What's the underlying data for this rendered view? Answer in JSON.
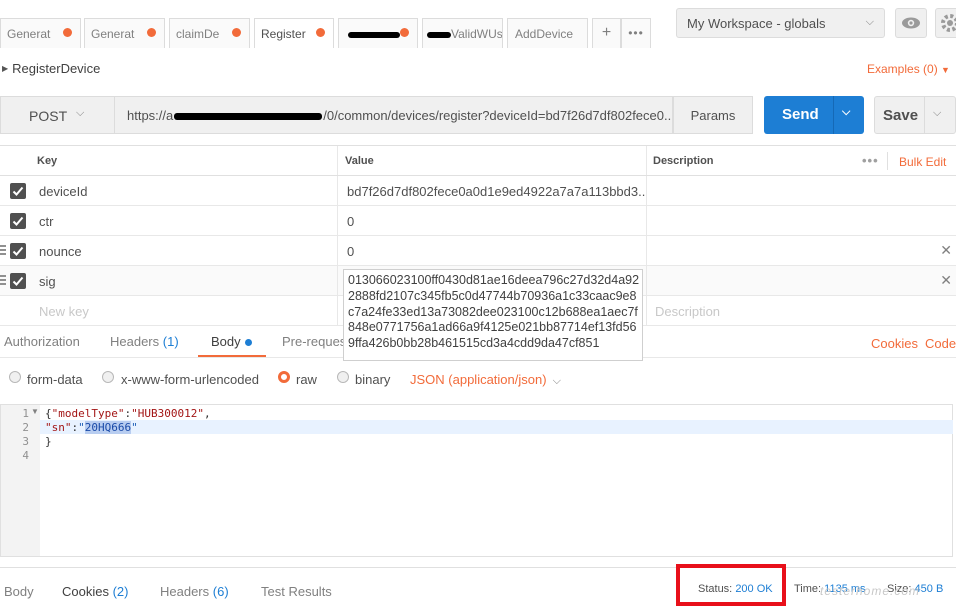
{
  "tabs": [
    {
      "label": "Generat",
      "active": false
    },
    {
      "label": "Generat",
      "active": false
    },
    {
      "label": "claimDe",
      "active": false
    },
    {
      "label": "Register",
      "active": true
    },
    {
      "label": "",
      "active": false
    },
    {
      "label": "ValidWUs",
      "active": false
    },
    {
      "label": "AddDevice",
      "active": false
    }
  ],
  "workspace": {
    "label": "My Workspace - globals"
  },
  "request": {
    "name": "RegisterDevice",
    "examples_label": "Examples (0)",
    "method": "POST",
    "url_prefix": "https://a",
    "url_suffix": "/0/common/devices/register?deviceId=bd7f26d7df802fece0...",
    "params_label": "Params",
    "send_label": "Send",
    "save_label": "Save"
  },
  "params_table": {
    "headers": {
      "key": "Key",
      "value": "Value",
      "description": "Description"
    },
    "bulk_edit": "Bulk Edit",
    "rows": [
      {
        "key": "deviceId",
        "value": "bd7f26d7df802fece0a0d1e9ed4922a7a7a113bbd3..."
      },
      {
        "key": "ctr",
        "value": "0"
      },
      {
        "key": "nounce",
        "value": "0"
      },
      {
        "key": "sig",
        "value": ""
      }
    ],
    "new_key_placeholder": "New key",
    "description_placeholder": "Description",
    "sig_full_value": "013066023100ff0430d81ae16deea796c27d32d4a922888fd2107c345fb5c0d47744b70936a1c33caac9e8c7a24fe33ed13a73082dee023100c12b688ea1aec7f848e0771756a1ad66a9f4125e021bb87714ef13fd569ffa426b0bb28b461515cd3a4cdd9da47cf851"
  },
  "section_tabs": {
    "authorization": "Authorization",
    "headers": "Headers",
    "headers_count": "(1)",
    "body": "Body",
    "prerequest": "Pre-reques",
    "cookies": "Cookies",
    "code": "Code"
  },
  "body_types": {
    "form_data": "form-data",
    "urlencoded": "x-www-form-urlencoded",
    "raw": "raw",
    "binary": "binary",
    "content_type": "JSON (application/json)",
    "selected": "raw"
  },
  "editor": {
    "line_numbers": [
      "1",
      "2",
      "3",
      "4"
    ],
    "line1_open": "{",
    "line1_key": "\"modelType\"",
    "line1_colon": ":",
    "line1_val": "\"HUB300012\"",
    "line1_comma": ",",
    "line2_key": "\"sn\"",
    "line2_colon": ":",
    "line2_q1": "\"",
    "line2_sel": "20HQ666",
    "line2_q2": "\"",
    "line3": "}"
  },
  "response": {
    "body": "Body",
    "cookies": "Cookies",
    "cookies_count": "(2)",
    "headers": "Headers",
    "headers_count": "(6)",
    "test_results": "Test Results",
    "status_label": "Status:",
    "status_value": "200 OK",
    "time_label": "Time:",
    "time_value": "1135 ms",
    "size_label": "Size:",
    "size_value": "450 B"
  },
  "watermark": "testerhome.com",
  "colors": {
    "accent": "#f26b3a",
    "primary": "#1d7ed4",
    "highlight_box": "#e8101a"
  }
}
